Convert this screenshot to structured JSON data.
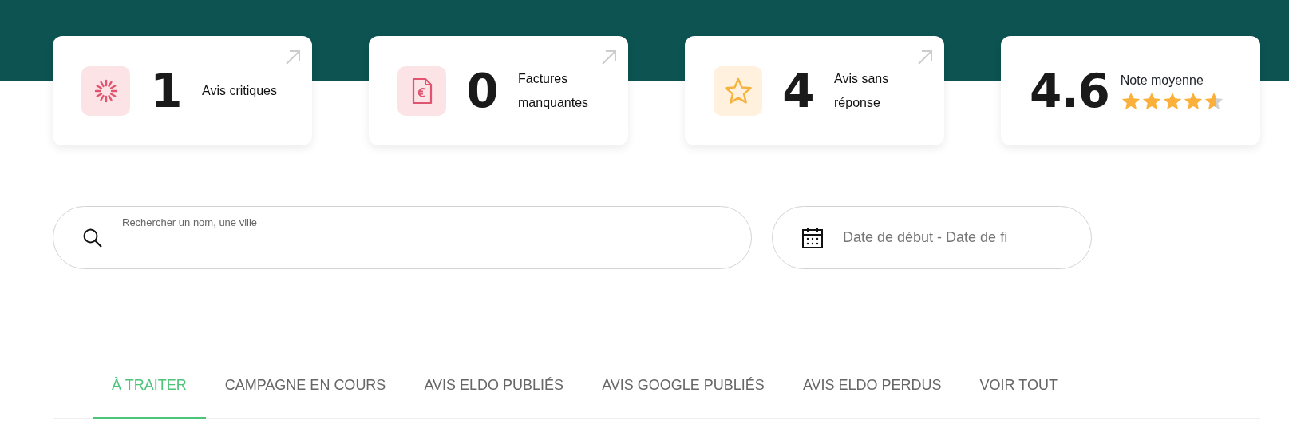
{
  "stat_cards": [
    {
      "kind": "critical",
      "value": "1",
      "label": "Avis critiques"
    },
    {
      "kind": "invoices",
      "value": "0",
      "label": "Factures manquantes"
    },
    {
      "kind": "unanswered",
      "value": "4",
      "label": "Avis sans réponse"
    },
    {
      "kind": "rating",
      "value": "4.6",
      "label": "Note moyenne",
      "stars": 4.6
    }
  ],
  "search": {
    "placeholder": "Rechercher un nom, une ville"
  },
  "date_range": {
    "placeholder": "Date de début - Date de fi"
  },
  "tabs": [
    {
      "label": "À TRAITER",
      "selected": true
    },
    {
      "label": "CAMPAGNE EN COURS",
      "selected": false
    },
    {
      "label": "AVIS ELDO PUBLIÉS",
      "selected": false
    },
    {
      "label": "AVIS GOOGLE PUBLIÉS",
      "selected": false
    },
    {
      "label": "AVIS ELDO PERDUS",
      "selected": false
    },
    {
      "label": "VOIR TOUT",
      "selected": false
    }
  ]
}
